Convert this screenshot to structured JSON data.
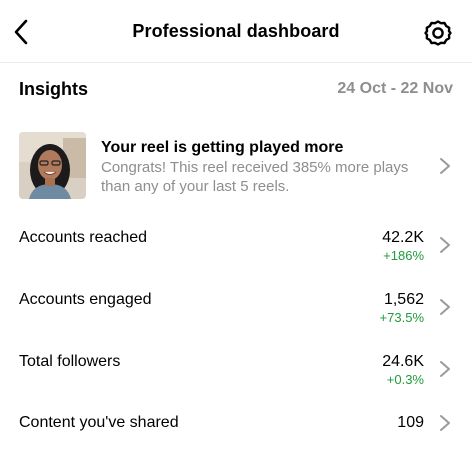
{
  "header": {
    "title": "Professional dashboard",
    "back_icon": "chevron-left-icon",
    "settings_icon": "gear-icon"
  },
  "insights": {
    "title": "Insights",
    "date_range": "24 Oct - 22 Nov"
  },
  "reel_card": {
    "headline": "Your reel is getting played more",
    "body": "Congrats! This reel received 385% more plays than any of your last 5 reels."
  },
  "metrics": [
    {
      "label": "Accounts reached",
      "value": "42.2K",
      "change": "+186%"
    },
    {
      "label": "Accounts engaged",
      "value": "1,562",
      "change": "+73.5%"
    },
    {
      "label": "Total followers",
      "value": "24.6K",
      "change": "+0.3%"
    },
    {
      "label": "Content you've shared",
      "value": "109",
      "change": ""
    }
  ],
  "colors": {
    "positive": "#1f9b3a",
    "muted": "#8e8e8e",
    "chevron": "#9a9a9a"
  }
}
